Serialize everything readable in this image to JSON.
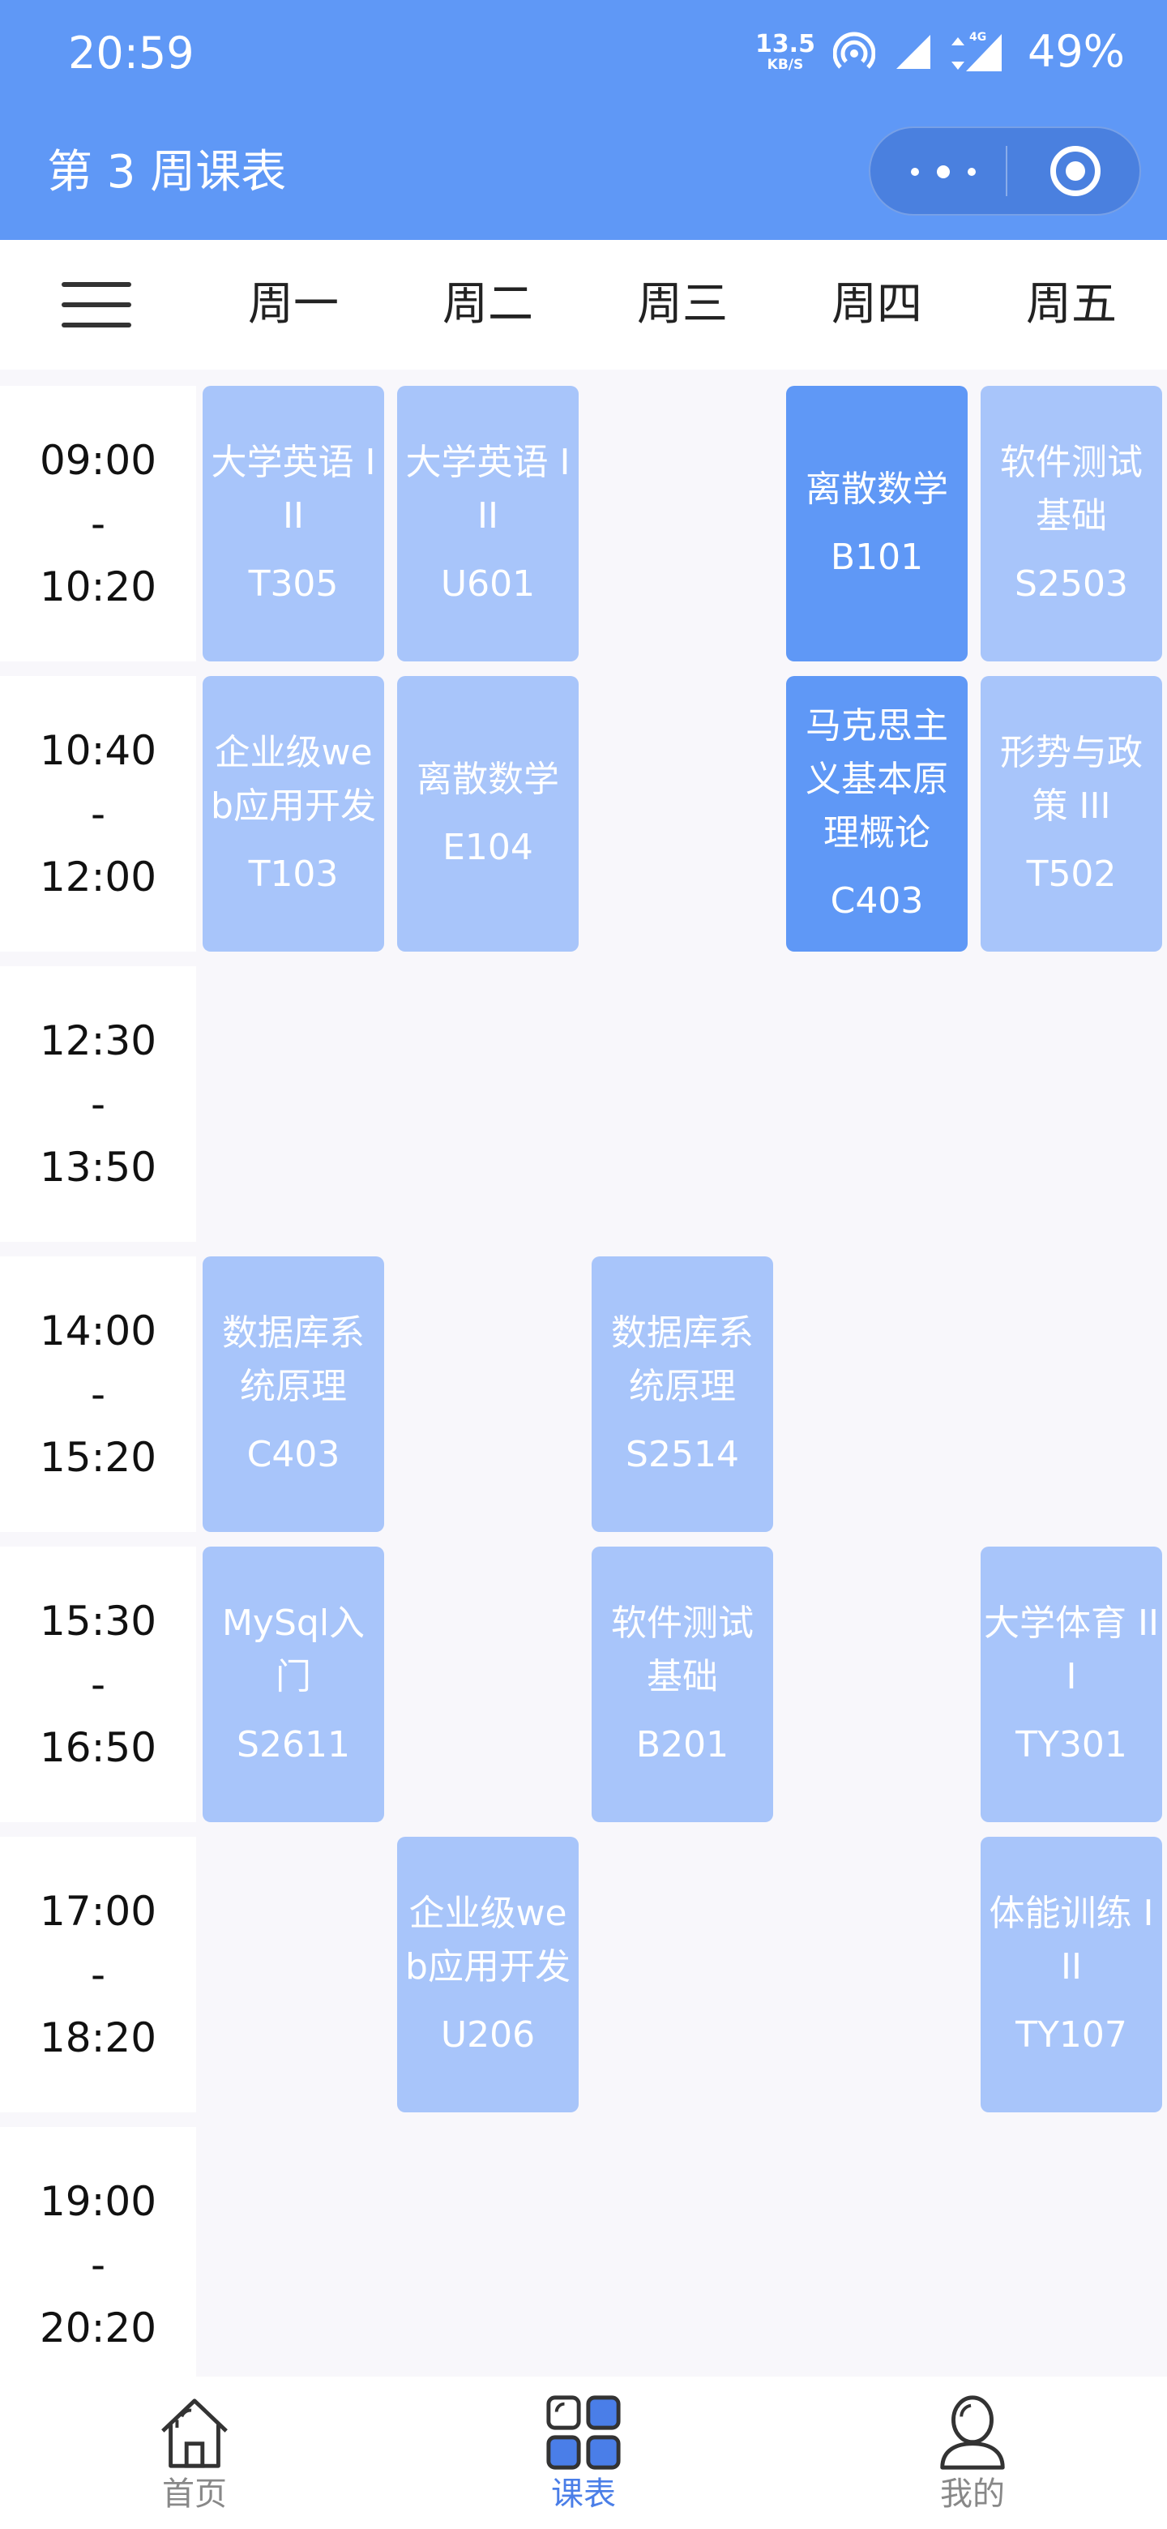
{
  "status_bar": {
    "time": "20:59",
    "net_speed": "13.5",
    "net_unit": "KB/S",
    "signal_label": "4G",
    "battery": "49%"
  },
  "nav": {
    "title": "第 3 周课表"
  },
  "colors": {
    "primary": "#5f98f6",
    "card": "#a8c5fa",
    "card_active": "#5f98f6",
    "page_bg": "#f8f7fb"
  },
  "week": {
    "days": [
      "周一",
      "周二",
      "周三",
      "周四",
      "周五"
    ]
  },
  "periods": [
    {
      "start": "09:00",
      "sep": "-",
      "end": "10:20"
    },
    {
      "start": "10:40",
      "sep": "-",
      "end": "12:00"
    },
    {
      "start": "12:30",
      "sep": "-",
      "end": "13:50"
    },
    {
      "start": "14:00",
      "sep": "-",
      "end": "15:20"
    },
    {
      "start": "15:30",
      "sep": "-",
      "end": "16:50"
    },
    {
      "start": "17:00",
      "sep": "-",
      "end": "18:20"
    },
    {
      "start": "19:00",
      "sep": "-",
      "end": "20:20"
    }
  ],
  "courses": [
    {
      "name": "大学英语 I II",
      "room": "T305",
      "day": 0,
      "period": 0,
      "highlight": false
    },
    {
      "name": "大学英语 I II",
      "room": "U601",
      "day": 1,
      "period": 0,
      "highlight": false
    },
    {
      "name": "离散数学",
      "room": "B101",
      "day": 3,
      "period": 0,
      "highlight": true
    },
    {
      "name": "软件测试基础",
      "room": "S2503",
      "day": 4,
      "period": 0,
      "highlight": false
    },
    {
      "name": "企业级web应用开发",
      "room": "T103",
      "day": 0,
      "period": 1,
      "highlight": false
    },
    {
      "name": "离散数学",
      "room": "E104",
      "day": 1,
      "period": 1,
      "highlight": false
    },
    {
      "name": "马克思主义基本原理概论",
      "room": "C403",
      "day": 3,
      "period": 1,
      "highlight": true
    },
    {
      "name": "形势与政策 III",
      "room": "T502",
      "day": 4,
      "period": 1,
      "highlight": false
    },
    {
      "name": "数据库系统原理",
      "room": "C403",
      "day": 0,
      "period": 3,
      "highlight": false
    },
    {
      "name": "数据库系统原理",
      "room": "S2514",
      "day": 2,
      "period": 3,
      "highlight": false
    },
    {
      "name": "MySql入门",
      "room": "S2611",
      "day": 0,
      "period": 4,
      "highlight": false
    },
    {
      "name": "软件测试基础",
      "room": "B201",
      "day": 2,
      "period": 4,
      "highlight": false
    },
    {
      "name": "大学体育 III",
      "room": "TY301",
      "day": 4,
      "period": 4,
      "highlight": false
    },
    {
      "name": "企业级web应用开发",
      "room": "U206",
      "day": 1,
      "period": 5,
      "highlight": false
    },
    {
      "name": "体能训练 I II",
      "room": "TY107",
      "day": 4,
      "period": 5,
      "highlight": false
    }
  ],
  "tabbar": {
    "items": [
      {
        "label": "首页",
        "icon": "home-icon",
        "active": false
      },
      {
        "label": "课表",
        "icon": "schedule-grid-icon",
        "active": true
      },
      {
        "label": "我的",
        "icon": "person-icon",
        "active": false
      }
    ]
  }
}
